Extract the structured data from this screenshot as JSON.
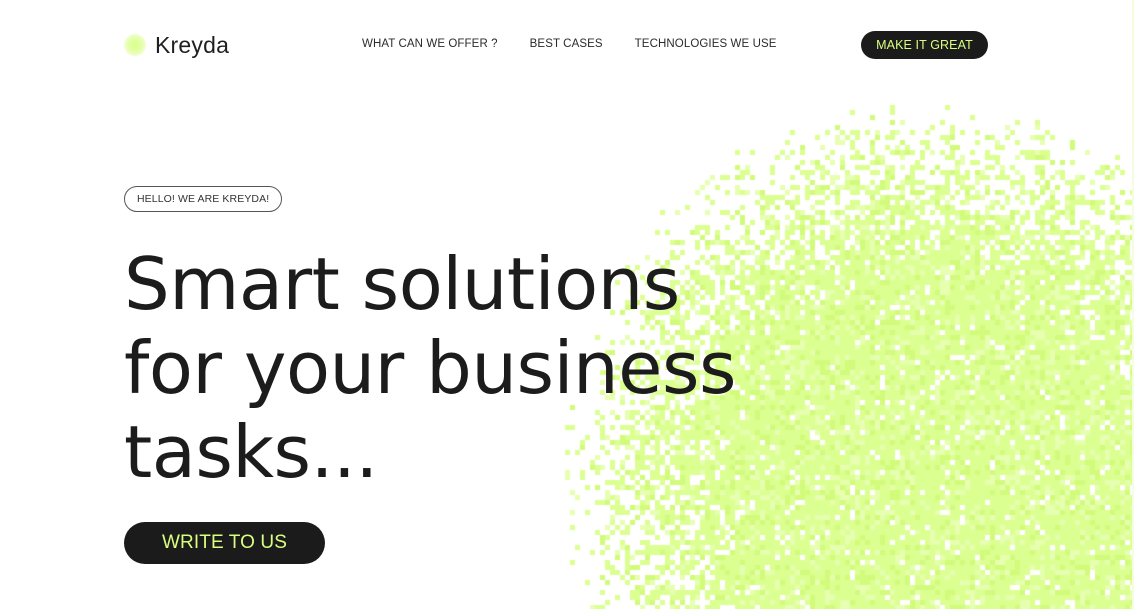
{
  "brand": {
    "name": "Kreyda"
  },
  "nav": {
    "items": [
      "WHAT CAN WE OFFER ?",
      "BEST CASES",
      "TECHNOLOGIES WE USE"
    ]
  },
  "header_cta": {
    "label": "MAKE IT GREAT"
  },
  "hero": {
    "badge": "HELLO! WE ARE KREYDA!",
    "headline_lines": [
      "Smart solutions",
      "for your business",
      "tasks..."
    ],
    "cta_label": "WRITE TO US"
  },
  "colors": {
    "accent": "#d9ff80",
    "dark": "#1b1b1b",
    "background": "#ffffff",
    "text": "#1c1c1c"
  },
  "decor": {
    "background_graphic": "pixel-dither-circle"
  }
}
